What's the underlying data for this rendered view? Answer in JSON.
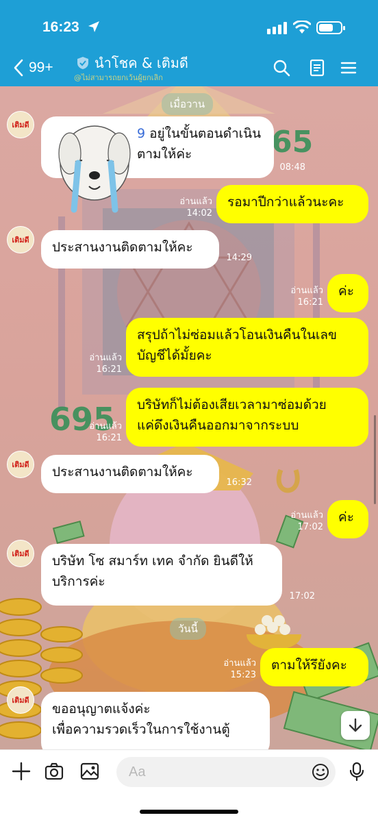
{
  "status": {
    "time": "16:23"
  },
  "header": {
    "back_count": "99+",
    "title": "นำโชค & เติมดี",
    "subtitle": "@ไม่สามารถยกเว้นผู้ยกเลิก"
  },
  "avatar_label": "เติมดี",
  "chat": {
    "date_yesterday": "เมื่อวาน",
    "date_today": "วันนี้",
    "bg_numbers": [
      "65",
      "695"
    ],
    "messages": [
      {
        "id": "m1",
        "text_line1": "อยู่ในขั้นตอนดำเนิน",
        "text_line2": "ตามให้ค่ะ",
        "time": "08:48",
        "partial_prefix": "9"
      },
      {
        "id": "m2",
        "text": "รอมาปีกว่าแล้วนะคะ",
        "read": "อ่านแล้ว",
        "time": "14:02"
      },
      {
        "id": "m3",
        "text": "ประสานงานติดตามให้คะ",
        "time": "14:29"
      },
      {
        "id": "m4",
        "text": "ค่ะ",
        "read": "อ่านแล้ว",
        "time": "16:21"
      },
      {
        "id": "m5",
        "text_line1": "สรุปถ้าไม่ซ่อมแล้วโอนเงินคืนในเลข",
        "text_line2": "บัญชีได้มั้ยคะ",
        "read": "อ่านแล้ว",
        "time": "16:21"
      },
      {
        "id": "m6",
        "text_line1": "บริษัทก็ไม่ต้องเสียเวลามาซ่อมด้วย",
        "text_line2": "แค่ดึงเงินคืนออกมาจากระบบ",
        "read": "อ่านแล้ว",
        "time": "16:21"
      },
      {
        "id": "m7",
        "text": "ประสานงานติดตามให้คะ",
        "time": "16:32"
      },
      {
        "id": "m8",
        "text": "ค่ะ",
        "read": "อ่านแล้ว",
        "time": "17:02"
      },
      {
        "id": "m9",
        "text_line1": "บริษัท โซ สมาร์ท เทค จำกัด ยินดีให้",
        "text_line2": "บริการค่ะ",
        "time": "17:02"
      },
      {
        "id": "m10",
        "text": "ตามให้รึยังคะ",
        "read": "อ่านแล้ว",
        "time": "15:23"
      },
      {
        "id": "m11",
        "text_line1": "ขออนุญาตแจ้งค่ะ",
        "text_line2": "เพื่อความรวดเร็วในการใช้งานตู้"
      }
    ]
  },
  "input": {
    "placeholder": "Aa"
  },
  "colors": {
    "header": "#1e9fd6",
    "outgoing": "#ffff00",
    "incoming": "#ffffff"
  },
  "icons": [
    "location-arrow-icon",
    "signal-icon",
    "wifi-icon",
    "battery-icon",
    "back-chevron-icon",
    "verified-shield-icon",
    "search-icon",
    "notes-icon",
    "menu-icon",
    "plus-icon",
    "camera-icon",
    "image-icon",
    "emoji-icon",
    "mic-icon",
    "scroll-down-icon"
  ]
}
